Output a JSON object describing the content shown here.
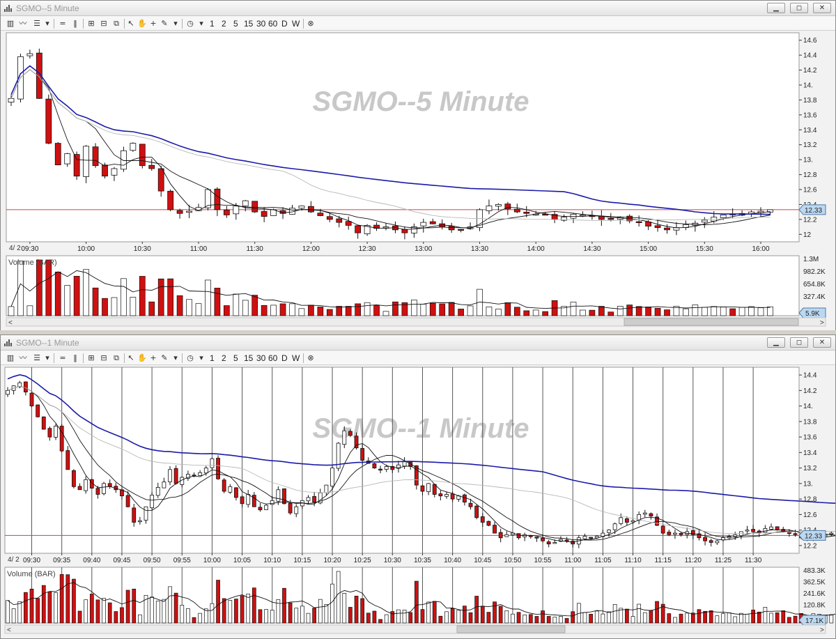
{
  "windows": [
    {
      "id": "w5",
      "title": "SGMO--5 Minute",
      "watermark": "SGMO--5 Minute",
      "volume_label": "Volume (BAR)",
      "date_label": "4/ 2",
      "price_ticks": [
        "14.6",
        "14.4",
        "14.2",
        "14.",
        "13.8",
        "13.6",
        "13.4",
        "13.2",
        "13.",
        "12.8",
        "12.6",
        "12.4",
        "12.2",
        "12"
      ],
      "price_badge": "12.33",
      "volume_ticks": [
        "1.3M",
        "982.2K",
        "654.8K",
        "327.4K"
      ],
      "volume_badge": "5.9K",
      "time_labels": [
        "09:30",
        "10:00",
        "10:30",
        "11:00",
        "11:30",
        "12:00",
        "12:30",
        "13:00",
        "13:30",
        "14:00",
        "14:30",
        "15:00",
        "15:30",
        "16:00"
      ]
    },
    {
      "id": "w1",
      "title": "SGMO--1 Minute",
      "watermark": "SGMO--1 Minute",
      "volume_label": "Volume (BAR)",
      "date_label": "4/ 2",
      "price_ticks": [
        "14.4",
        "14.2",
        "14.",
        "13.8",
        "13.6",
        "13.4",
        "13.2",
        "13.",
        "12.8",
        "12.6",
        "12.4",
        "12.2"
      ],
      "price_badge": "12.33",
      "volume_ticks": [
        "483.3K",
        "362.5K",
        "241.6K",
        "120.8K"
      ],
      "volume_badge": "17.1K",
      "time_labels": [
        "09:30",
        "09:35",
        "09:40",
        "09:45",
        "09:50",
        "09:55",
        "10:00",
        "10:05",
        "10:10",
        "10:15",
        "10:20",
        "10:25",
        "10:30",
        "10:35",
        "10:40",
        "10:45",
        "10:50",
        "10:55",
        "11:00",
        "11:05",
        "11:10",
        "11:15",
        "11:20",
        "11:25",
        "11:30"
      ]
    }
  ],
  "toolbar": {
    "intervals": [
      "1",
      "2",
      "5",
      "15",
      "30",
      "60",
      "D",
      "W"
    ]
  },
  "icons": [
    "bar-chart-icon",
    "line-chart-icon",
    "candle-icon",
    "dropdown-icon",
    "hlines-icon",
    "vlines-icon",
    "zoom-in-icon",
    "zoom-out-icon",
    "zoom-fit-icon",
    "cursor-icon",
    "pan-hand-icon",
    "crosshair-icon",
    "pencil-icon",
    "clock-icon",
    "close-circle-icon",
    "minimize-icon",
    "restore-icon",
    "close-icon"
  ],
  "colors": {
    "down": "#d01010",
    "up": "#ffffff",
    "ma_blue": "#1a1aa8",
    "ma_black": "#111111",
    "ma_gray": "#b8b8b8",
    "ref_line": "#d04040",
    "badge": "#bcd8f0"
  },
  "chart_data": [
    {
      "type": "candlestick",
      "title": "SGMO--5 Minute",
      "y_range": [
        11.9,
        14.7
      ],
      "reference_line": 12.33,
      "last_price": 12.33,
      "interval_minutes": 5,
      "start_time": "09:20",
      "x_labels": [
        "09:30",
        "10:00",
        "10:30",
        "11:00",
        "11:30",
        "12:00",
        "12:30",
        "13:00",
        "13:30",
        "14:00",
        "14:30",
        "15:00",
        "15:30",
        "16:00"
      ],
      "closes": [
        13.82,
        14.38,
        14.42,
        13.82,
        13.22,
        12.93,
        13.08,
        12.78,
        13.18,
        12.92,
        12.78,
        12.88,
        13.12,
        13.22,
        12.92,
        12.88,
        12.58,
        12.33,
        12.28,
        12.31,
        12.36,
        12.6,
        12.33,
        12.26,
        12.38,
        12.45,
        12.3,
        12.24,
        12.33,
        12.28,
        12.35,
        12.38,
        12.3,
        12.25,
        12.2,
        12.16,
        12.12,
        12.02,
        12.12,
        12.08,
        12.1,
        12.06,
        12.02,
        12.1,
        12.16,
        12.14,
        12.1,
        12.06,
        12.06,
        12.1,
        12.33,
        12.38,
        12.4,
        12.34,
        12.3,
        12.28,
        12.27,
        12.26,
        12.2,
        12.23,
        12.27,
        12.26,
        12.24,
        12.2,
        12.21,
        12.23,
        12.18,
        12.16,
        12.11,
        12.09,
        12.06,
        12.09,
        12.13,
        12.15,
        12.19,
        12.23,
        12.26,
        12.27,
        12.28,
        12.3,
        12.31,
        12.33
      ]
    },
    {
      "type": "candlestick",
      "title": "SGMO--1 Minute",
      "y_range": [
        12.1,
        14.5
      ],
      "reference_line": 12.33,
      "last_price": 12.33,
      "interval_minutes": 1,
      "start_time": "09:26",
      "x_labels": [
        "09:30",
        "09:35",
        "09:40",
        "09:45",
        "09:50",
        "09:55",
        "10:00",
        "10:05",
        "10:10",
        "10:15",
        "10:20",
        "10:25",
        "10:30",
        "10:35",
        "10:40",
        "10:45",
        "10:50",
        "10:55",
        "11:00",
        "11:05",
        "11:10",
        "11:15",
        "11:20",
        "11:25",
        "11:30"
      ],
      "closes": [
        14.2,
        14.26,
        14.3,
        14.18,
        14.0,
        13.86,
        13.7,
        13.6,
        13.74,
        13.42,
        13.18,
        12.96,
        12.92,
        13.05,
        12.94,
        12.86,
        13.0,
        12.96,
        12.92,
        12.84,
        12.7,
        12.5,
        12.52,
        12.7,
        12.85,
        12.95,
        13.02,
        13.18,
        13.0,
        13.08,
        13.12,
        13.1,
        13.14,
        13.2,
        13.32,
        13.06,
        12.9,
        12.96,
        12.82,
        12.74,
        12.86,
        12.7,
        12.66,
        12.72,
        12.78,
        12.92,
        12.74,
        12.62,
        12.7,
        12.78,
        12.82,
        12.76,
        12.88,
        12.98,
        13.2,
        13.52,
        13.68,
        13.62,
        13.46,
        13.3,
        13.26,
        13.2,
        13.18,
        13.22,
        13.18,
        13.24,
        13.28,
        13.22,
        12.98,
        12.9,
        13.0,
        12.86,
        12.84,
        12.86,
        12.8,
        12.84,
        12.76,
        12.7,
        12.56,
        12.5,
        12.46,
        12.36,
        12.3,
        12.34,
        12.36,
        12.3,
        12.34,
        12.32,
        12.3,
        12.26,
        12.22,
        12.24,
        12.28,
        12.26,
        12.22,
        12.3,
        12.32,
        12.3,
        12.32,
        12.36,
        12.4,
        12.48,
        12.56,
        12.5,
        12.52,
        12.6,
        12.62,
        12.58,
        12.46,
        12.36,
        12.34,
        12.36,
        12.34,
        12.38,
        12.34,
        12.3,
        12.26,
        12.24,
        12.26,
        12.3,
        12.32,
        12.34,
        12.38,
        12.4,
        12.38,
        12.36,
        12.42,
        12.44,
        12.4,
        12.38,
        12.36,
        12.34,
        12.3,
        12.28,
        12.3,
        12.32,
        12.34,
        12.36,
        12.33
      ]
    }
  ]
}
